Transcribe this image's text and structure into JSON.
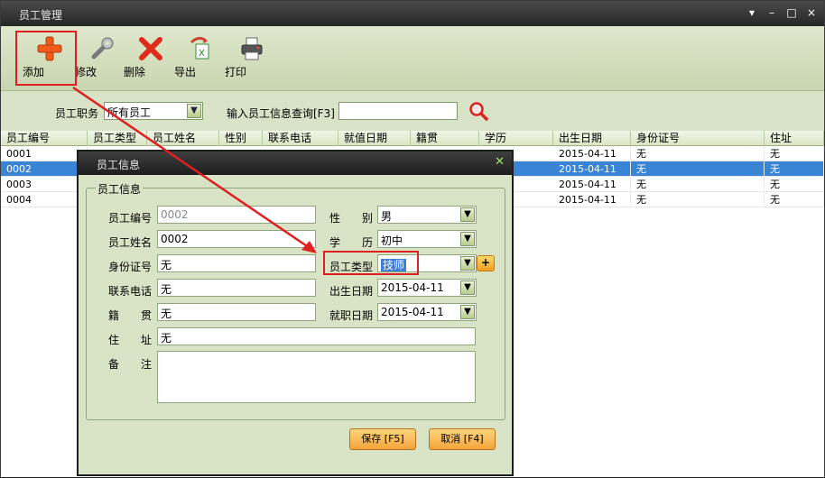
{
  "window": {
    "title": "员工管理",
    "controls": [
      "▾",
      "–",
      "□",
      "×"
    ]
  },
  "toolbar": {
    "add": "添加",
    "edit": "修改",
    "delete": "删除",
    "export": "导出",
    "print": "打印"
  },
  "filter": {
    "job_label": "员工职务",
    "job_value": "所有员工",
    "search_label": "输入员工信息查询[F3]",
    "search_value": ""
  },
  "grid": {
    "columns": [
      "员工编号",
      "员工类型",
      "员工姓名",
      "性别",
      "联系电话",
      "就值日期",
      "籍贯",
      "学历",
      "出生日期",
      "身份证号",
      "住址"
    ],
    "rows": [
      {
        "id": "0001",
        "birth": "2015-04-11",
        "idcard": "无",
        "addr": "无"
      },
      {
        "id": "0002",
        "birth": "2015-04-11",
        "idcard": "无",
        "addr": "无"
      },
      {
        "id": "0003",
        "birth": "2015-04-11",
        "idcard": "无",
        "addr": "无"
      },
      {
        "id": "0004",
        "birth": "2015-04-11",
        "idcard": "无",
        "addr": "无"
      }
    ],
    "selected_index": 1
  },
  "dialog": {
    "title": "员工信息",
    "group_title": "员工信息",
    "labels": {
      "emp_id": "员工编号",
      "emp_name": "员工姓名",
      "idcard": "身份证号",
      "phone": "联系电话",
      "native": "籍　　贯",
      "address": "住　　址",
      "note": "备　　注",
      "gender": "性　　别",
      "education": "学　　历",
      "emp_type": "员工类型",
      "birth": "出生日期",
      "hire": "就职日期"
    },
    "values": {
      "emp_id": "0002",
      "emp_name": "0002",
      "idcard": "无",
      "phone": "无",
      "native": "无",
      "address": "无",
      "note": "",
      "gender": "男",
      "education": "初中",
      "emp_type": "技师",
      "birth": "2015-04-11",
      "hire": "2015-04-11"
    },
    "plus": "+",
    "save": "保存 [F5]",
    "cancel": "取消 [F4]"
  }
}
